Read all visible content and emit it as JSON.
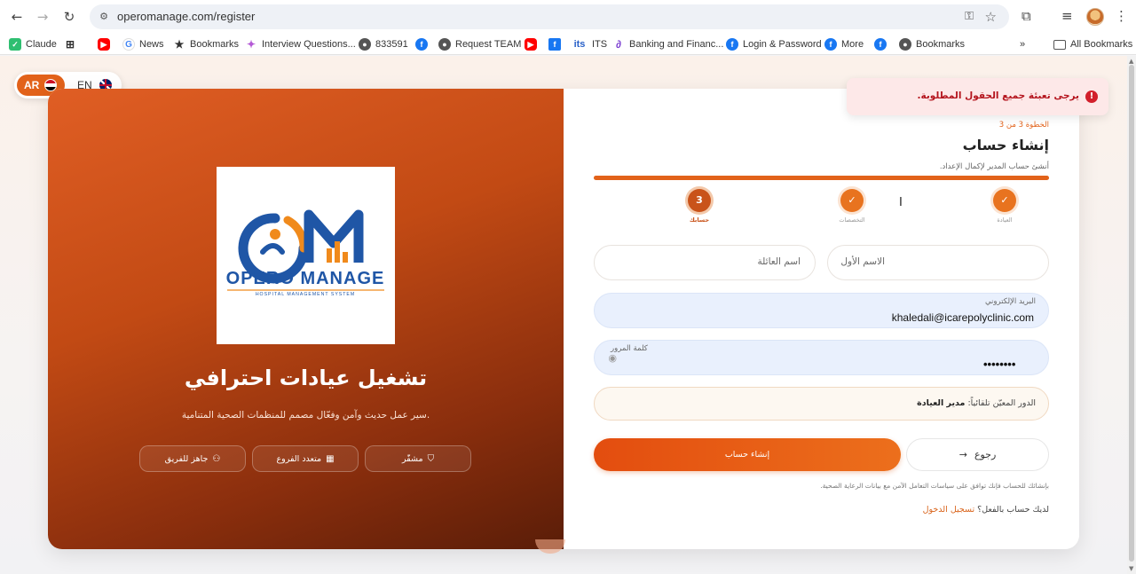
{
  "browser": {
    "url": "operomanage.com/register",
    "bookmarks": [
      {
        "label": "Claude",
        "icon": "claude-icon"
      },
      {
        "label": "",
        "icon": "apps-grid-icon"
      },
      {
        "label": "",
        "icon": "youtube-icon"
      },
      {
        "label": "News",
        "icon": "google-icon"
      },
      {
        "label": "Bookmarks",
        "icon": "star-icon"
      },
      {
        "label": "Interview Questions...",
        "icon": "sparkle-icon"
      },
      {
        "label": "833591",
        "icon": "globe-icon"
      },
      {
        "label": "",
        "icon": "facebook-icon"
      },
      {
        "label": "Request TEAM",
        "icon": "globe-icon"
      },
      {
        "label": "",
        "icon": "youtube-icon"
      },
      {
        "label": "",
        "icon": "facebook-square-icon"
      },
      {
        "label": "ITS",
        "icon": "its-icon"
      },
      {
        "label": "Banking and Financ...",
        "icon": "curl-icon"
      },
      {
        "label": "Login & Password",
        "icon": "facebook-icon"
      },
      {
        "label": "More",
        "icon": "facebook-icon"
      },
      {
        "label": "",
        "icon": "facebook-icon"
      },
      {
        "label": "Bookmarks",
        "icon": "globe-icon"
      }
    ],
    "all_bookmarks": "All Bookmarks"
  },
  "lang": {
    "ar": "AR",
    "en": "EN"
  },
  "toast": {
    "message": "يرجى تعبئة جميع الحقول المطلوبة."
  },
  "hero": {
    "logo_text": "OPERO MANAGE",
    "logo_tagline": "HOSPITAL MANAGEMENT SYSTEM",
    "title": "تشغيل عيادات احترافي",
    "subtitle": "سير عمل حديث وآمن وفعّال مصمم للمنظمات الصحية المتنامية.",
    "features": [
      {
        "label": "مشفّر",
        "icon": "shield-icon"
      },
      {
        "label": "متعدد الفروع",
        "icon": "building-icon"
      },
      {
        "label": "جاهز للفريق",
        "icon": "team-icon"
      }
    ]
  },
  "form": {
    "step_of": "الخطوة 3 من 3",
    "title": "إنشاء حساب",
    "subtitle": "أنشئ حساب المدير لإكمال الإعداد.",
    "progress": 1.0,
    "steps": [
      {
        "label": "العيادة",
        "value": "✓"
      },
      {
        "label": "التخصصات",
        "value": "✓"
      },
      {
        "label": "حسابك",
        "value": "3"
      }
    ],
    "first_name": {
      "placeholder": "الاسم الأول",
      "value": ""
    },
    "last_name": {
      "placeholder": "اسم العائلة",
      "value": ""
    },
    "email": {
      "label": "البريد الإلكتروني",
      "value": "khaledali@icarepolyclinic.com"
    },
    "password": {
      "label": "كلمة المرور",
      "value": "••••••••"
    },
    "role_prefix": "الدور المعيّن تلقائياً:",
    "role_value": "مدير العيادة",
    "create_button": "إنشاء حساب",
    "back_button": "رجوع",
    "terms": "بإنشائك للحساب فإنك توافق على سياسات التعامل الآمن مع بيانات الرعاية الصحية.",
    "have_account": "لديك حساب بالفعل؟",
    "login_link": "تسجيل الدخول"
  },
  "colors": {
    "accent": "#e2621a",
    "error": "#d21f2b",
    "filled_field": "#e9f0fd"
  }
}
